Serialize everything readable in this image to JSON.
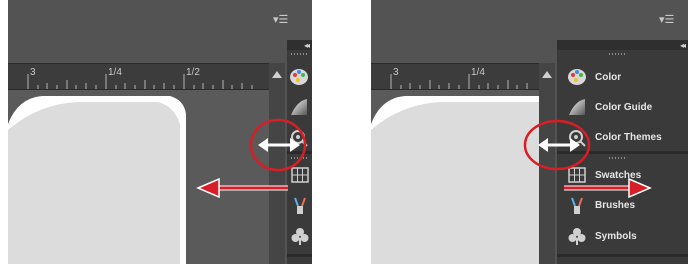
{
  "left_pane": {
    "ruler_labels": [
      "3",
      "1/4",
      "1/2"
    ],
    "menu_icon": "panel-menu-icon",
    "collapse_icon": "collapse-chevrons-icon"
  },
  "right_pane": {
    "ruler_labels": [
      "3",
      "1/4"
    ],
    "menu_icon": "panel-menu-icon",
    "collapse_icon": "collapse-chevrons-icon",
    "panels": [
      {
        "label": "Color",
        "icon": "color-palette-icon"
      },
      {
        "label": "Color Guide",
        "icon": "color-guide-icon"
      },
      {
        "label": "Color Themes",
        "icon": "color-themes-icon"
      },
      {
        "label": "Swatches",
        "icon": "swatches-icon"
      },
      {
        "label": "Brushes",
        "icon": "brushes-icon"
      },
      {
        "label": "Symbols",
        "icon": "symbols-icon"
      }
    ]
  },
  "colors": {
    "highlight_circle": "#d81e26",
    "arrow_red": "#d81e26",
    "resize_arrow": "#ffffff",
    "artboard": "#dcdcdc"
  }
}
